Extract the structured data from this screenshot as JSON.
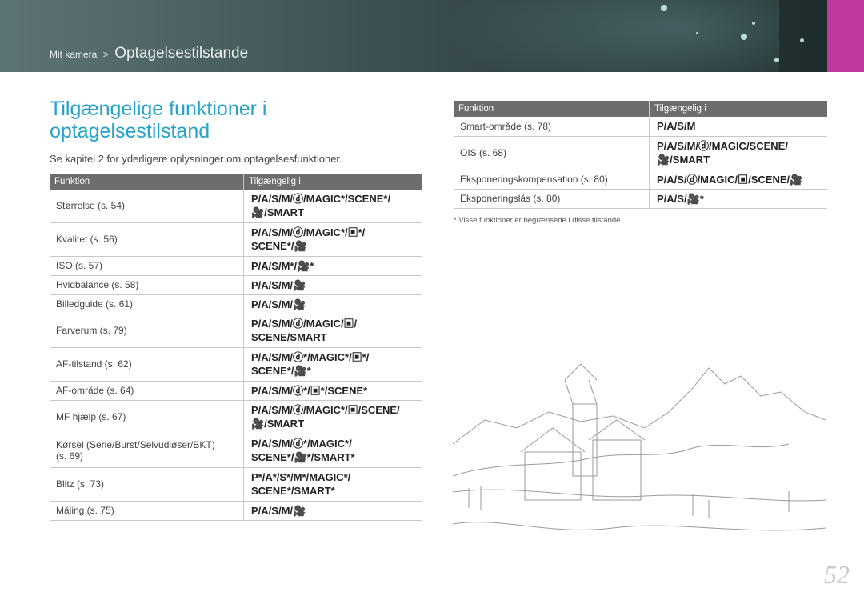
{
  "header": {
    "breadcrumb_parent": "Mit kamera",
    "breadcrumb_sep": ">",
    "breadcrumb_current": "Optagelsestilstande",
    "accent_color": "#c0399d"
  },
  "title": "Tilgængelige funktioner i optagelsestilstand",
  "intro": "Se kapitel 2 for yderligere oplysninger om optagelsesfunktioner.",
  "table_left": {
    "headers": [
      "Funktion",
      "Tilgængelig i"
    ],
    "rows": [
      {
        "function": "Størrelse (s. 54)",
        "modes": "P/A/S/M/ⓓ/MAGIC*/SCENE*/\n🎥/SMART"
      },
      {
        "function": "Kvalitet (s. 56)",
        "modes": "P/A/S/M/ⓓ/MAGIC*/▣*/\nSCENE*/🎥"
      },
      {
        "function": "ISO (s. 57)",
        "modes": "P/A/S/M*/🎥*"
      },
      {
        "function": "Hvidbalance (s. 58)",
        "modes": "P/A/S/M/🎥"
      },
      {
        "function": "Billedguide (s. 61)",
        "modes": "P/A/S/M/🎥"
      },
      {
        "function": "Farverum (s. 79)",
        "modes": "P/A/S/M/ⓓ/MAGIC/▣/\nSCENE/SMART"
      },
      {
        "function": "AF-tilstand (s. 62)",
        "modes": "P/A/S/M/ⓓ*/MAGIC*/▣*/\nSCENE*/🎥*"
      },
      {
        "function": "AF-område (s. 64)",
        "modes": "P/A/S/M/ⓓ*/▣*/SCENE*"
      },
      {
        "function": "MF hjælp (s. 67)",
        "modes": "P/A/S/M/ⓓ/MAGIC*/▣/SCENE/\n🎥/SMART"
      },
      {
        "function": "Kørsel (Serie/Burst/Selvudløser/BKT)\n(s. 69)",
        "modes": "P/A/S/M/ⓓ*/MAGIC*/\nSCENE*/🎥*/SMART*"
      },
      {
        "function": "Blitz (s. 73)",
        "modes": "P*/A*/S*/M*/MAGIC*/\nSCENE*/SMART*"
      },
      {
        "function": "Måling (s. 75)",
        "modes": "P/A/S/M/🎥"
      }
    ]
  },
  "table_right": {
    "headers": [
      "Funktion",
      "Tilgængelig i"
    ],
    "rows": [
      {
        "function": "Smart-område (s. 78)",
        "modes": "P/A/S/M"
      },
      {
        "function": "OIS (s. 68)",
        "modes": "P/A/S/M/ⓓ/MAGIC/SCENE/\n🎥/SMART"
      },
      {
        "function": "Eksponeringskompensation (s. 80)",
        "modes": "P/A/S/ⓓ/MAGIC/▣/SCENE/🎥"
      },
      {
        "function": "Eksponeringslås (s. 80)",
        "modes": "P/A/S/🎥*"
      }
    ]
  },
  "footnote": "* Visse funktioner er begrænsede i disse tilstande.",
  "page_number": "52"
}
